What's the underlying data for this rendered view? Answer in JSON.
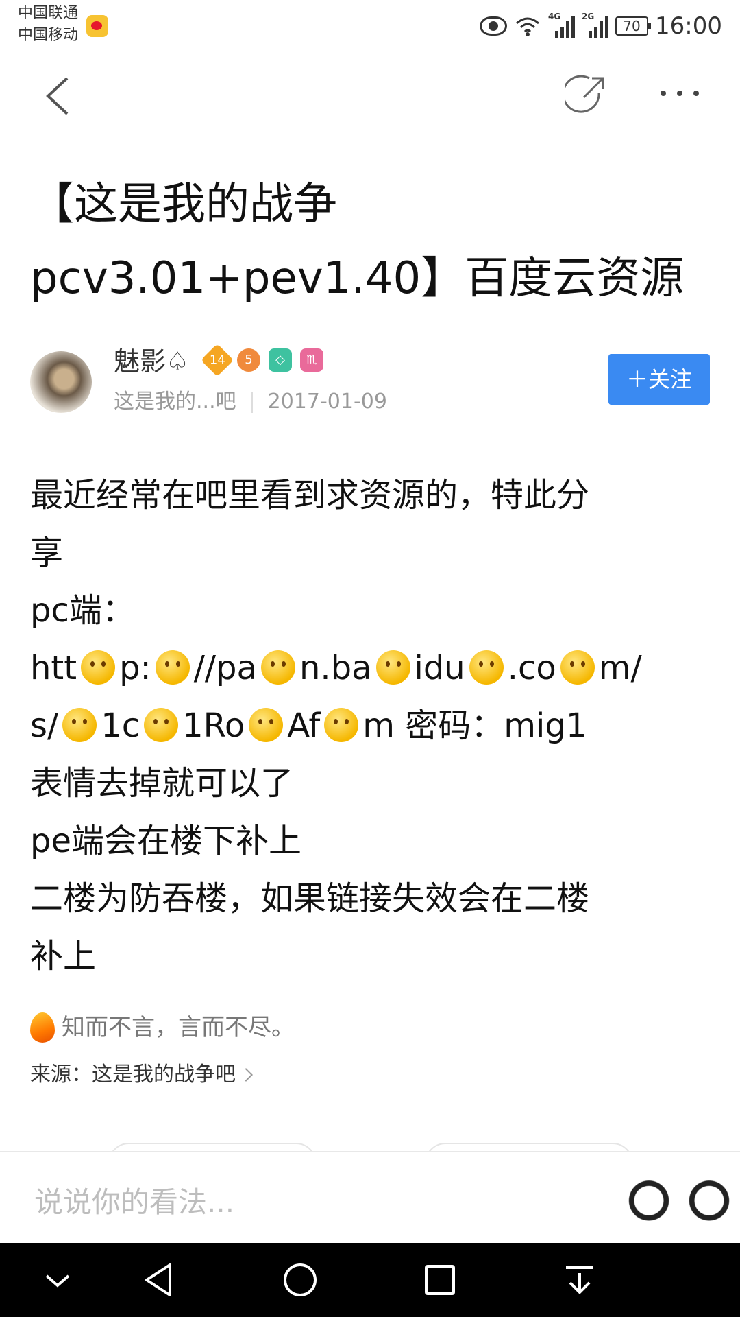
{
  "status_bar": {
    "carrier_1": "中国联通",
    "carrier_2": "中国移动",
    "net_1": "4G",
    "net_2": "2G",
    "battery": "70",
    "time": "16:00"
  },
  "post": {
    "title_line1": "【这是我的战争",
    "title_line2": "pcv3.01+pev1.40】百度云资源",
    "author": {
      "name": "魅影♤",
      "level": "14",
      "badge_2": "5",
      "forum": "这是我的...吧",
      "date": "2017-01-09"
    },
    "follow_label": "＋关注",
    "body": {
      "line1": "最近经常在吧里看到求资源的，特此分",
      "line2": "享",
      "line3": "pc端：",
      "link_seg": [
        "htt",
        "p:",
        "//pa",
        "n.ba",
        "idu",
        ".co",
        "m/"
      ],
      "link2_seg": [
        "s/",
        "1c",
        "1Ro",
        "Af",
        "m 密码：mig1"
      ],
      "line6": "表情去掉就可以了",
      "line7": "pe端会在楼下补上",
      "line8": "二楼为防吞楼，如果链接失效会在二楼",
      "line9": "补上"
    },
    "signature": "知而不言，言而不尽。",
    "source": "来源：这是我的战争吧"
  },
  "comment_bar": {
    "placeholder": "说说你的看法..."
  },
  "colors": {
    "accent": "#3a8af2"
  }
}
